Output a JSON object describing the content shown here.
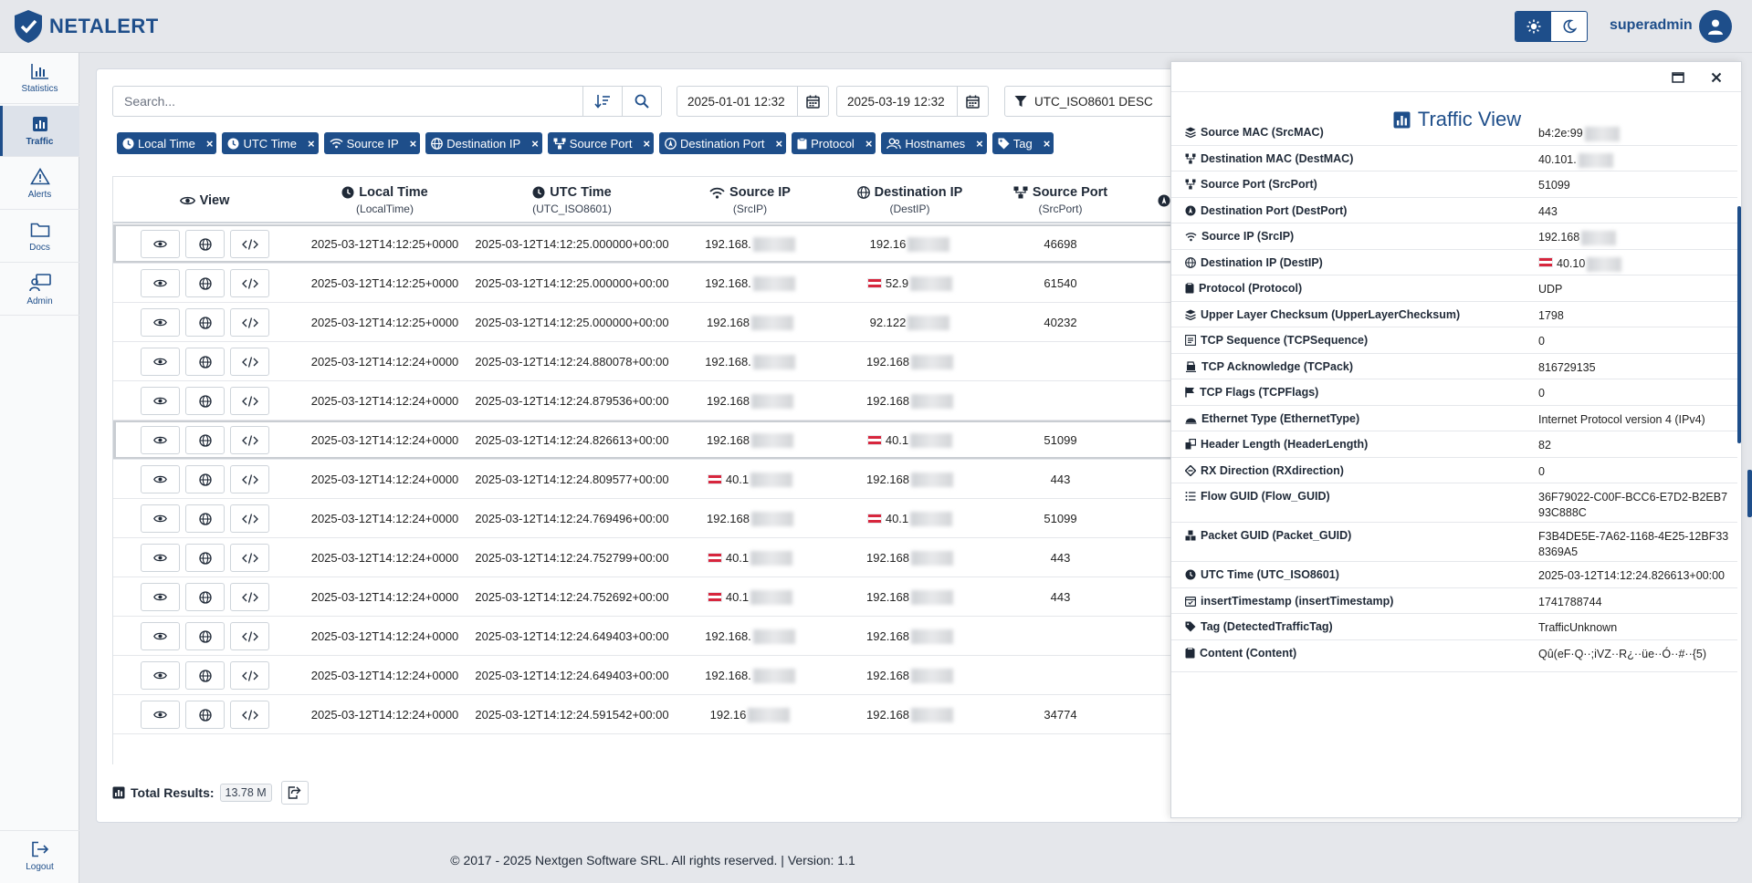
{
  "brand": {
    "name": "NETALERT"
  },
  "header": {
    "username": "superadmin"
  },
  "sidebar": {
    "items": [
      {
        "label": "Statistics"
      },
      {
        "label": "Traffic"
      },
      {
        "label": "Alerts"
      },
      {
        "label": "Docs"
      },
      {
        "label": "Admin"
      }
    ],
    "logout": "Logout"
  },
  "search": {
    "placeholder": "Search..."
  },
  "filters": {
    "date_from": "2025-01-01 12:32",
    "date_to": "2025-03-19 12:32",
    "sort": "UTC_ISO8601 DESC"
  },
  "chips": [
    {
      "label": "Local Time"
    },
    {
      "label": "UTC Time"
    },
    {
      "label": "Source IP"
    },
    {
      "label": "Destination IP"
    },
    {
      "label": "Source Port"
    },
    {
      "label": "Destination Port"
    },
    {
      "label": "Protocol"
    },
    {
      "label": "Hostnames"
    },
    {
      "label": "Tag"
    }
  ],
  "table": {
    "columns": [
      {
        "title": "View",
        "sub": ""
      },
      {
        "title": "Local Time",
        "sub": "(LocalTime)"
      },
      {
        "title": "UTC Time",
        "sub": "(UTC_ISO8601)"
      },
      {
        "title": "Source IP",
        "sub": "(SrcIP)"
      },
      {
        "title": "Destination IP",
        "sub": "(DestIP)"
      },
      {
        "title": "Source Port",
        "sub": "(SrcPort)"
      }
    ],
    "rows": [
      {
        "local": "2025-03-12T14:12:25+0000",
        "utc": "2025-03-12T14:12:25.000000+00:00",
        "src": "192.168.",
        "dst": "192.16",
        "sport": "46698"
      },
      {
        "local": "2025-03-12T14:12:25+0000",
        "utc": "2025-03-12T14:12:25.000000+00:00",
        "src": "192.168.",
        "dst": "52.9",
        "sport": "61540"
      },
      {
        "local": "2025-03-12T14:12:25+0000",
        "utc": "2025-03-12T14:12:25.000000+00:00",
        "src": "192.168",
        "dst": "92.122",
        "sport": "40232"
      },
      {
        "local": "2025-03-12T14:12:24+0000",
        "utc": "2025-03-12T14:12:24.880078+00:00",
        "src": "192.168.",
        "dst": "192.168",
        "sport": ""
      },
      {
        "local": "2025-03-12T14:12:24+0000",
        "utc": "2025-03-12T14:12:24.879536+00:00",
        "src": "192.168",
        "dst": "192.168",
        "sport": ""
      },
      {
        "local": "2025-03-12T14:12:24+0000",
        "utc": "2025-03-12T14:12:24.826613+00:00",
        "src": "192.168",
        "dst": "40.1",
        "sport": "51099"
      },
      {
        "local": "2025-03-12T14:12:24+0000",
        "utc": "2025-03-12T14:12:24.809577+00:00",
        "src": "40.1",
        "dst": "192.168",
        "sport": "443"
      },
      {
        "local": "2025-03-12T14:12:24+0000",
        "utc": "2025-03-12T14:12:24.769496+00:00",
        "src": "192.168",
        "dst": "40.1",
        "sport": "51099"
      },
      {
        "local": "2025-03-12T14:12:24+0000",
        "utc": "2025-03-12T14:12:24.752799+00:00",
        "src": "40.1",
        "dst": "192.168",
        "sport": "443"
      },
      {
        "local": "2025-03-12T14:12:24+0000",
        "utc": "2025-03-12T14:12:24.752692+00:00",
        "src": "40.1",
        "dst": "192.168",
        "sport": "443"
      },
      {
        "local": "2025-03-12T14:12:24+0000",
        "utc": "2025-03-12T14:12:24.649403+00:00",
        "src": "192.168.",
        "dst": "192.168",
        "sport": ""
      },
      {
        "local": "2025-03-12T14:12:24+0000",
        "utc": "2025-03-12T14:12:24.649403+00:00",
        "src": "192.168.",
        "dst": "192.168",
        "sport": ""
      },
      {
        "local": "2025-03-12T14:12:24+0000",
        "utc": "2025-03-12T14:12:24.591542+00:00",
        "src": "192.16",
        "dst": "192.168",
        "sport": "34774"
      }
    ]
  },
  "totals": {
    "label": "Total Results:",
    "value": "13.78 M"
  },
  "panel": {
    "title": "Traffic View",
    "fields": [
      {
        "key": "Source MAC (SrcMAC)",
        "value": "b4:2e:99"
      },
      {
        "key": "Destination MAC (DestMAC)",
        "value": "40.101."
      },
      {
        "key": "Source Port (SrcPort)",
        "value": "51099"
      },
      {
        "key": "Destination Port (DestPort)",
        "value": "443"
      },
      {
        "key": "Source IP (SrcIP)",
        "value": "192.168"
      },
      {
        "key": "Destination IP (DestIP)",
        "value": "40.10"
      },
      {
        "key": "Protocol (Protocol)",
        "value": "UDP"
      },
      {
        "key": "Upper Layer Checksum (UpperLayerChecksum)",
        "value": "1798"
      },
      {
        "key": "TCP Sequence (TCPSequence)",
        "value": "0"
      },
      {
        "key": "TCP Acknowledge (TCPack)",
        "value": "816729135"
      },
      {
        "key": "TCP Flags (TCPFlags)",
        "value": "0"
      },
      {
        "key": "Ethernet Type (EthernetType)",
        "value": "Internet Protocol version 4 (IPv4)"
      },
      {
        "key": "Header Length (HeaderLength)",
        "value": "82"
      },
      {
        "key": "RX Direction (RXdirection)",
        "value": "0"
      },
      {
        "key": "Flow GUID (Flow_GUID)",
        "value": "36F79022-C00F-BCC6-E7D2-B2EB793C888C"
      },
      {
        "key": "Packet GUID (Packet_GUID)",
        "value": "F3B4DE5E-7A62-1168-4E25-12BF338369A5"
      },
      {
        "key": "UTC Time (UTC_ISO8601)",
        "value": "2025-03-12T14:12:24.826613+00:00"
      },
      {
        "key": "insertTimestamp (insertTimestamp)",
        "value": "1741788744"
      },
      {
        "key": "Tag (DetectedTrafficTag)",
        "value": "TrafficUnknown"
      },
      {
        "key": "Content (Content)",
        "value": "Qû(eF·Q··;iVZ··R¿··üe··Ó··#··{5)"
      }
    ]
  },
  "footer": {
    "text": "© 2017 - 2025 Nextgen Software SRL. All rights reserved. | Version: 1.1"
  }
}
